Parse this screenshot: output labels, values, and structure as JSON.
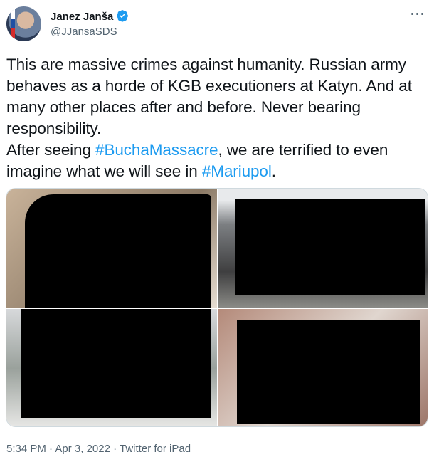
{
  "author": {
    "name": "Janez Janša",
    "handle": "@JJansaSDS",
    "verified_icon": "verified-badge-icon",
    "avatar_icon": "avatar"
  },
  "tweet": {
    "text_1": "This are massive crimes against humanity. Russian army behaves as a horde of KGB executioners at Katyn. And at many other places after and before. Never bearing responsibility.\nAfter seeing ",
    "hashtag_1": "#BuchaMassacre",
    "text_2": ", we are terrified to even imagine what we will see in ",
    "hashtag_2": "#Mariupol",
    "text_3": "."
  },
  "meta": {
    "time": "5:34 PM",
    "sep1": " · ",
    "date": "Apr 3, 2022",
    "sep2": " · ",
    "source": "Twitter for iPad"
  },
  "colors": {
    "link": "#1d9bf0",
    "verified": "#1d9bf0",
    "secondary_text": "#536471"
  }
}
